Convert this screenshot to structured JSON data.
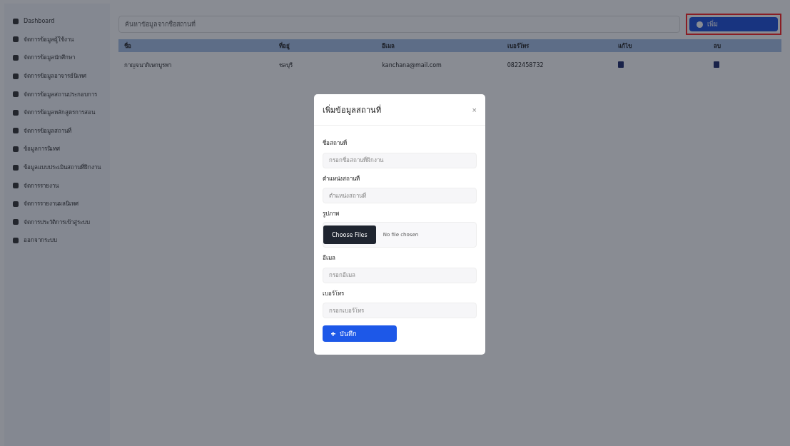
{
  "sidebar": {
    "items": [
      {
        "label": "Dashboard"
      },
      {
        "label": "จัดการข้อมูลผู้ใช้งาน"
      },
      {
        "label": "จัดการข้อมูลนักศึกษา"
      },
      {
        "label": "จัดการข้อมูลอาจารย์นิเทศ"
      },
      {
        "label": "จัดการข้อมูลสถานประกอบการ"
      },
      {
        "label": "จัดการข้อมูลหลักสูตรการสอน"
      },
      {
        "label": "จัดการข้อมูลสถานที่"
      },
      {
        "label": "ข้อมูลการนิเทศ"
      },
      {
        "label": "ข้อมูลแบบประเมินสถานที่ฝึกงาน"
      },
      {
        "label": "จัดการรายงาน"
      },
      {
        "label": "จัดการรายงานผลนิเทศ"
      },
      {
        "label": "จัดการประวัติการเข้าสู่ระบบ"
      },
      {
        "label": "ออกจากระบบ"
      }
    ]
  },
  "toolbar": {
    "search": {
      "placeholder": "ค้นหาข้อมูลจากชื่อสถานที่"
    },
    "add_button": "เพิ่ม"
  },
  "table": {
    "columns": [
      "ชื่อ",
      "ที่อยู่",
      "อีเมล",
      "เบอร์โทร",
      "แก้ไข",
      "ลบ"
    ],
    "rows": [
      {
        "name": "กาญจนาภิเษกบูรพา",
        "address": "ชลบุรี",
        "email": "kanchana@mail.com",
        "phone": "0822458732"
      }
    ]
  },
  "modal": {
    "title": "เพิ่มข้อมูลสถานที่",
    "close": "×",
    "fields": [
      {
        "kind": "text",
        "label": "ชื่อสถานที่",
        "placeholder": "กรอกชื่อสถานที่ฝึกงาน"
      },
      {
        "kind": "text",
        "label": "ตำแหน่งสถานที่",
        "placeholder": "ตำแหน่งสถานที่"
      },
      {
        "kind": "file",
        "label": "รูปภาพ",
        "button": "Choose Files",
        "status": "No file chosen"
      },
      {
        "kind": "text",
        "label": "อีเมล",
        "placeholder": "กรอกอีเมล"
      },
      {
        "kind": "text",
        "label": "เบอร์โทร",
        "placeholder": "กรอกเบอร์โทร"
      }
    ],
    "submit": "บันทึก"
  }
}
